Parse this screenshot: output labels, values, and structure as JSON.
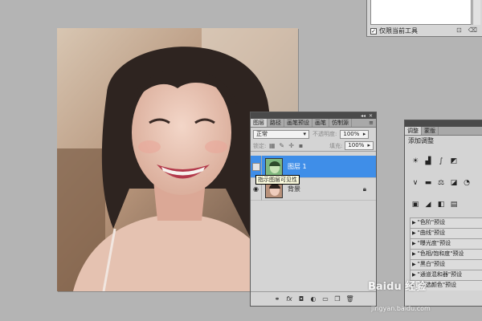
{
  "preset_panel": {
    "checkbox_label": "仅限当前工具",
    "checkbox_checked": true,
    "checkbox_mark": "✓"
  },
  "layers_panel": {
    "tabs": [
      "图层",
      "路径",
      "画笔预设",
      "画笔",
      "仿制源"
    ],
    "active_tab": 0,
    "blend_mode": "正常",
    "opacity_label": "不透明度:",
    "opacity_value": "100%",
    "lock_label": "锁定:",
    "fill_label": "填充:",
    "fill_value": "100%",
    "layers": [
      {
        "name": "图层 1",
        "selected": true
      },
      {
        "name": "背景",
        "selected": false,
        "locked": true
      }
    ],
    "tooltip": "指示图层可见性",
    "bottom_icons": [
      "link-icon",
      "fx-icon",
      "mask-icon",
      "adjustment-icon",
      "group-icon",
      "new-layer-icon",
      "trash-icon"
    ]
  },
  "adjustments_panel": {
    "tabs": [
      "调整",
      "蒙版"
    ],
    "heading": "添加调整",
    "presets": [
      "\"色阶\"预设",
      "\"曲线\"预设",
      "\"曝光度\"预设",
      "\"色相/饱和度\"预设",
      "\"黑白\"预设",
      "\"通道混和器\"预设",
      "\"可选颜色\"预设"
    ]
  },
  "watermark": {
    "text": "Baidu 经验",
    "url": "jingyan.baidu.com"
  },
  "colors": {
    "workspace": "#b4b4b4",
    "panel": "#d4d4d4",
    "selected_layer": "#3f8ee8",
    "tooltip": "#ffffe1"
  }
}
